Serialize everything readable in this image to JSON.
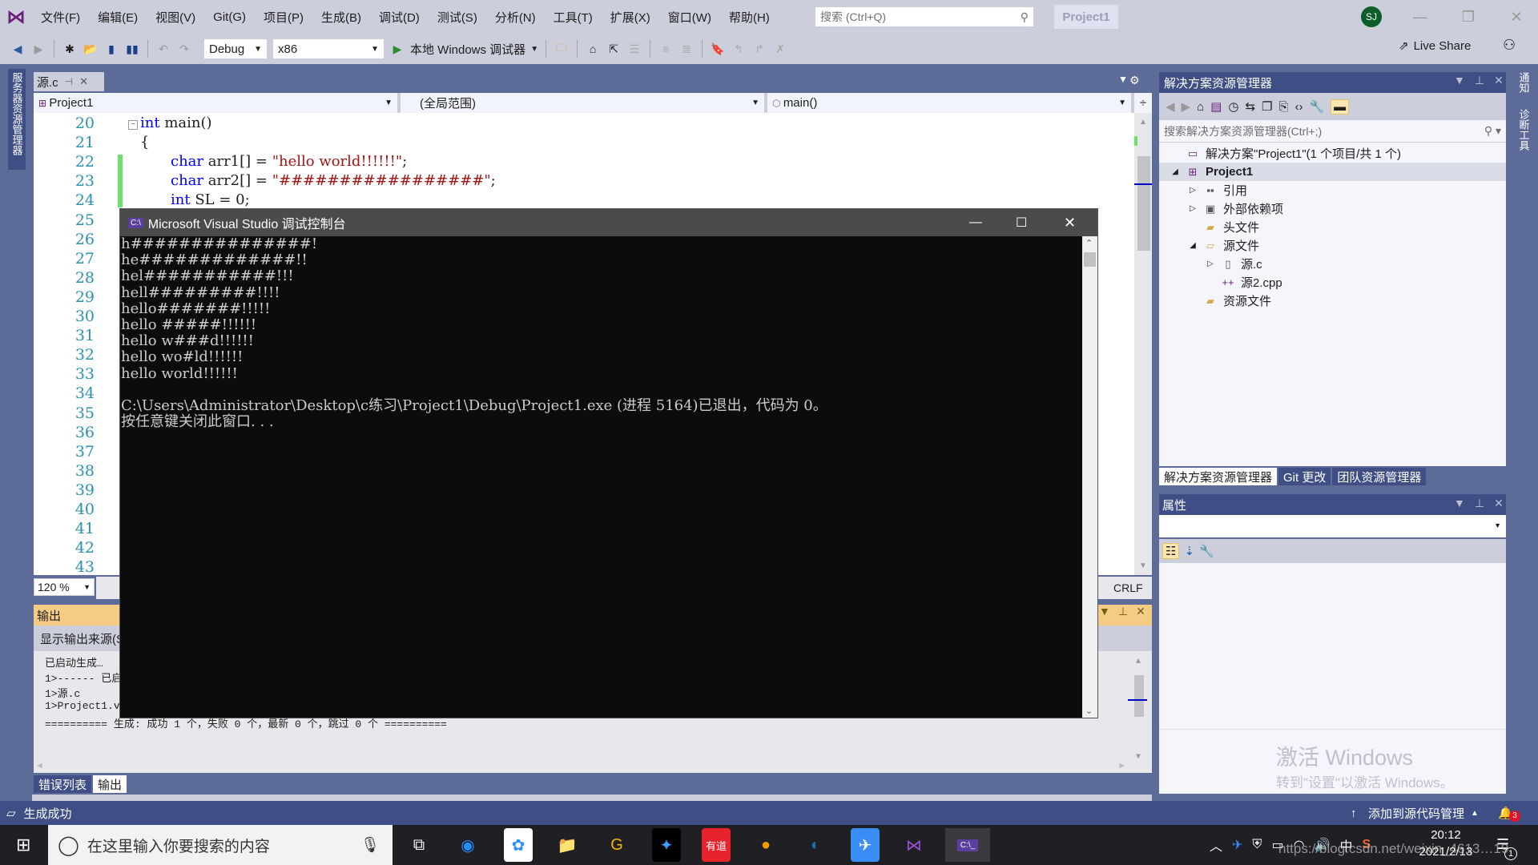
{
  "menubar": {
    "items": [
      "文件(F)",
      "编辑(E)",
      "视图(V)",
      "Git(G)",
      "项目(P)",
      "生成(B)",
      "调试(D)",
      "测试(S)",
      "分析(N)",
      "工具(T)",
      "扩展(X)",
      "窗口(W)",
      "帮助(H)"
    ],
    "search_placeholder": "搜索 (Ctrl+Q)",
    "project_badge": "Project1",
    "avatar_initials": "SJ"
  },
  "toolbar": {
    "config": "Debug",
    "platform": "x86",
    "run_label": "本地 Windows 调试器",
    "live_share": "Live Share"
  },
  "left_strip": {
    "server_explorer": "服务器资源管理器"
  },
  "editor": {
    "tab_label": "源.c",
    "nav_project": "Project1",
    "nav_scope": "(全局范围)",
    "nav_member": "main()",
    "zoom": "120 %",
    "line_ending": "CRLF",
    "line_numbers": [
      "20",
      "21",
      "22",
      "23",
      "24",
      "25",
      "26",
      "27",
      "28",
      "29",
      "30",
      "31",
      "32",
      "33",
      "34",
      "35",
      "36",
      "37",
      "38",
      "39",
      "40",
      "41",
      "42",
      "43"
    ],
    "code": [
      {
        "kw": "int",
        "rest": " main()"
      },
      {
        "kw": "",
        "rest": "{"
      },
      {
        "kw": "char",
        "rest": " arr1[] = ",
        "str": "\"hello world!!!!!!\"",
        "end": ";"
      },
      {
        "kw": "char",
        "rest": " arr2[] = ",
        "str": "\"#################\"",
        "end": ";"
      },
      {
        "kw": "int",
        "rest": " SL = 0;"
      }
    ]
  },
  "console": {
    "title": "Microsoft Visual Studio 调试控制台",
    "lines": [
      "h###############!",
      "he#############!!",
      "hel###########!!!",
      "hell#########!!!!",
      "hello#######!!!!!",
      "hello #####!!!!!!",
      "hello w###d!!!!!!",
      "hello wo#ld!!!!!!",
      "hello world!!!!!!",
      "",
      "C:\\Users\\Administrator\\Desktop\\c练习\\Project1\\Debug\\Project1.exe (进程 5164)已退出，代码为 0。",
      "按任意键关闭此窗口. . ."
    ]
  },
  "output": {
    "title": "输出",
    "source_label": "显示输出来源(S",
    "lines": [
      "已启动生成…",
      "1>------ 已启",
      "1>源.c",
      "1>Project1.v",
      "========== 生成: 成功 1 个，失败 0 个，最新 0 个，跳过 0 个 =========="
    ],
    "tabs": [
      "错误列表",
      "输出"
    ]
  },
  "solution_explorer": {
    "title": "解决方案资源管理器",
    "search_placeholder": "搜索解决方案资源管理器(Ctrl+;)",
    "tree": [
      {
        "label": "解决方案\"Project1\"(1 个项目/共 1 个)",
        "level": 0,
        "expander": "",
        "icon": "solution-icon"
      },
      {
        "label": "Project1",
        "level": 0,
        "expander": "◢",
        "icon": "project-icon",
        "bold": true,
        "selected": true
      },
      {
        "label": "引用",
        "level": 1,
        "expander": "▷",
        "icon": "references-icon"
      },
      {
        "label": "外部依赖项",
        "level": 1,
        "expander": "▷",
        "icon": "external-deps-icon"
      },
      {
        "label": "头文件",
        "level": 1,
        "expander": "",
        "icon": "folder-icon"
      },
      {
        "label": "源文件",
        "level": 1,
        "expander": "◢",
        "icon": "folder-open-icon"
      },
      {
        "label": "源.c",
        "level": 2,
        "expander": "▷",
        "icon": "c-file-icon"
      },
      {
        "label": "源2.cpp",
        "level": 2,
        "expander": "",
        "icon": "cpp-file-icon"
      },
      {
        "label": "资源文件",
        "level": 1,
        "expander": "",
        "icon": "folder-icon"
      }
    ],
    "tabs": [
      "解决方案资源管理器",
      "Git 更改",
      "团队资源管理器"
    ]
  },
  "properties": {
    "title": "属性"
  },
  "right_strip": {
    "tabs": [
      "通知",
      "诊断工具"
    ]
  },
  "activation": {
    "title": "激活 Windows",
    "subtitle": "转到\"设置\"以激活 Windows。"
  },
  "statusbar": {
    "status": "生成成功",
    "source_control": "添加到源代码管理",
    "notifications": "3"
  },
  "taskbar": {
    "search_placeholder": "在这里输入你要搜索的内容",
    "time": "20:12",
    "date": "2021/2/13",
    "ime": "中",
    "action_center_count": "1",
    "watermark": "https://blog.csdn.net/weixin_4613…19"
  }
}
